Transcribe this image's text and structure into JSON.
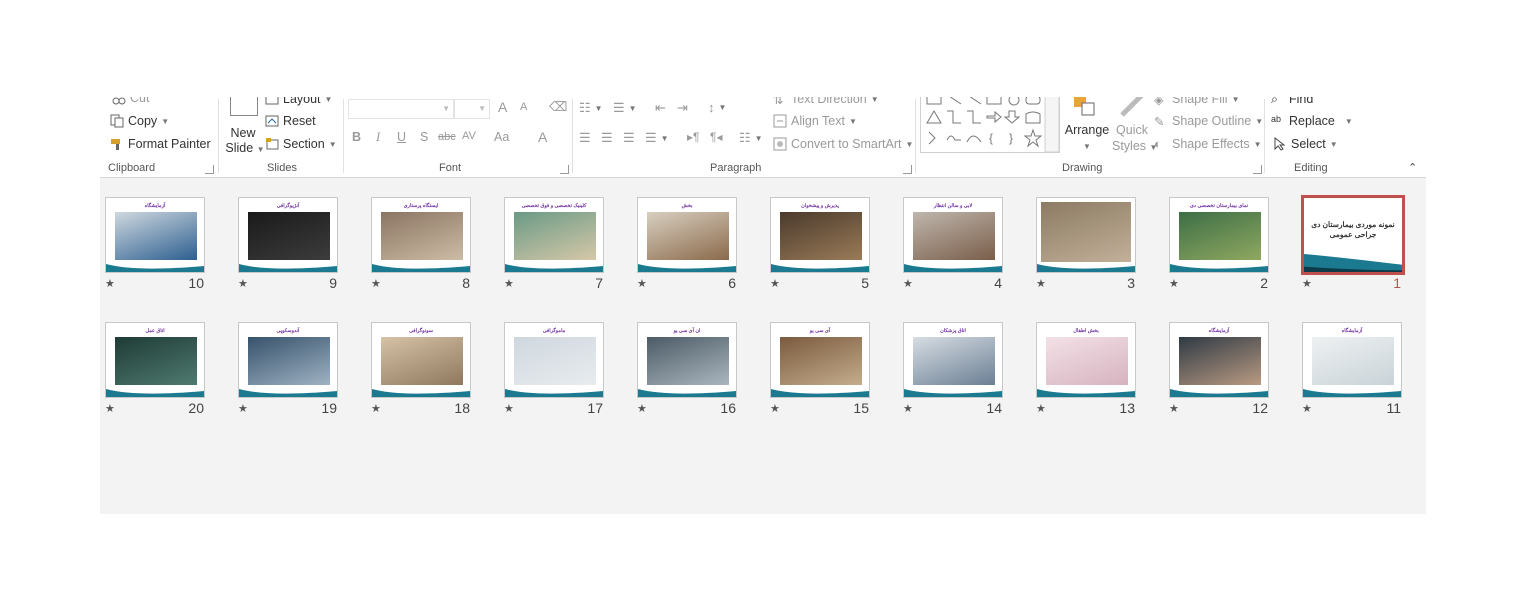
{
  "ribbon": {
    "clipboard": {
      "cut": "Cut",
      "copy": "Copy",
      "format_painter": "Format Painter",
      "label": "Clipboard"
    },
    "slides": {
      "new_slide_1": "New",
      "new_slide_2": "Slide",
      "layout": "Layout",
      "reset": "Reset",
      "section": "Section",
      "label": "Slides"
    },
    "font": {
      "label": "Font",
      "bold": "B",
      "italic": "I",
      "underline": "U",
      "shadow": "S",
      "strike": "abc",
      "spacing": "AV",
      "case": "Aa",
      "color": "A",
      "grow": "A",
      "shrink": "A"
    },
    "paragraph": {
      "label": "Paragraph",
      "text_direction": "Text Direction",
      "align_text": "Align Text",
      "convert_smartart": "Convert to SmartArt"
    },
    "drawing": {
      "label": "Drawing",
      "arrange": "Arrange",
      "quick_styles_1": "Quick",
      "quick_styles_2": "Styles",
      "shape_fill": "Shape Fill",
      "shape_outline": "Shape Outline",
      "shape_effects": "Shape Effects"
    },
    "editing": {
      "label": "Editing",
      "find": "Find",
      "replace": "Replace",
      "select": "Select"
    }
  },
  "slides": [
    {
      "num": "1",
      "title": "نمونه موردی بیمارستان دی جراحی عمومی",
      "selected": true,
      "kind": "title"
    },
    {
      "num": "2",
      "title": "نمای بیمارستان تخصصی دی",
      "kind": "render"
    },
    {
      "num": "3",
      "title": "",
      "kind": "aerial"
    },
    {
      "num": "4",
      "title": "لابی و سالن انتظار",
      "kind": "lobby"
    },
    {
      "num": "5",
      "title": "پذیرش و پیشخوان",
      "kind": "desk"
    },
    {
      "num": "6",
      "title": "بخش",
      "kind": "room"
    },
    {
      "num": "7",
      "title": "کلینیک تخصصی و فوق تخصصی",
      "kind": "clinic"
    },
    {
      "num": "8",
      "title": "ایستگاه پرستاری",
      "kind": "station"
    },
    {
      "num": "9",
      "title": "آنژیوگرافی",
      "kind": "dark"
    },
    {
      "num": "10",
      "title": "آزمایشگاه",
      "kind": "lab"
    },
    {
      "num": "11",
      "title": "آزمایشگاه",
      "kind": "light"
    },
    {
      "num": "12",
      "title": "آزمایشگاه",
      "kind": "arm"
    },
    {
      "num": "13",
      "title": "بخش اطفال",
      "kind": "pink"
    },
    {
      "num": "14",
      "title": "اتاق پزشکان",
      "kind": "people"
    },
    {
      "num": "15",
      "title": "آی سی یو",
      "kind": "ward"
    },
    {
      "num": "16",
      "title": "ان آی سی یو",
      "kind": "nicu"
    },
    {
      "num": "17",
      "title": "ماموگرافی",
      "kind": "mammo"
    },
    {
      "num": "18",
      "title": "سونوگرافی",
      "kind": "sono"
    },
    {
      "num": "19",
      "title": "آندوسکوپی",
      "kind": "endo"
    },
    {
      "num": "20",
      "title": "اتاق عمل",
      "kind": "or"
    }
  ],
  "star_glyph": "★",
  "colors": {
    "selection": "#c0504d",
    "title_text": "#7030a0",
    "swoosh": "#1c7a90"
  }
}
